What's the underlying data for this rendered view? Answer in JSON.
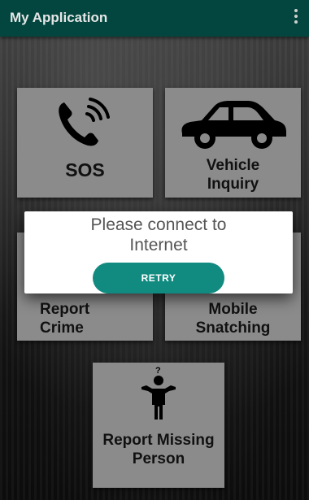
{
  "appbar": {
    "title": "My Application",
    "overflow_icon": "more-vert-icon"
  },
  "tiles": {
    "sos": {
      "label": "SOS",
      "icon": "phone-ringing-icon"
    },
    "vehicle": {
      "label_line1": "Vehicle",
      "label_line2": "Inquiry",
      "icon": "car-icon"
    },
    "report_crime": {
      "label_line1": "Report",
      "label_line2": "Crime"
    },
    "mobile": {
      "label_line1": "Mobile",
      "label_line2": "Snatching"
    },
    "missing": {
      "label_line1": "Report Missing",
      "label_line2": "Person",
      "icon": "person-question-icon"
    }
  },
  "dialog": {
    "message_line1": "Please connect to",
    "message_line2": "Internet",
    "button": "RETRY"
  },
  "colors": {
    "appbar": "#02463f",
    "accent": "#118a80",
    "tile": "#8b8b8b"
  }
}
